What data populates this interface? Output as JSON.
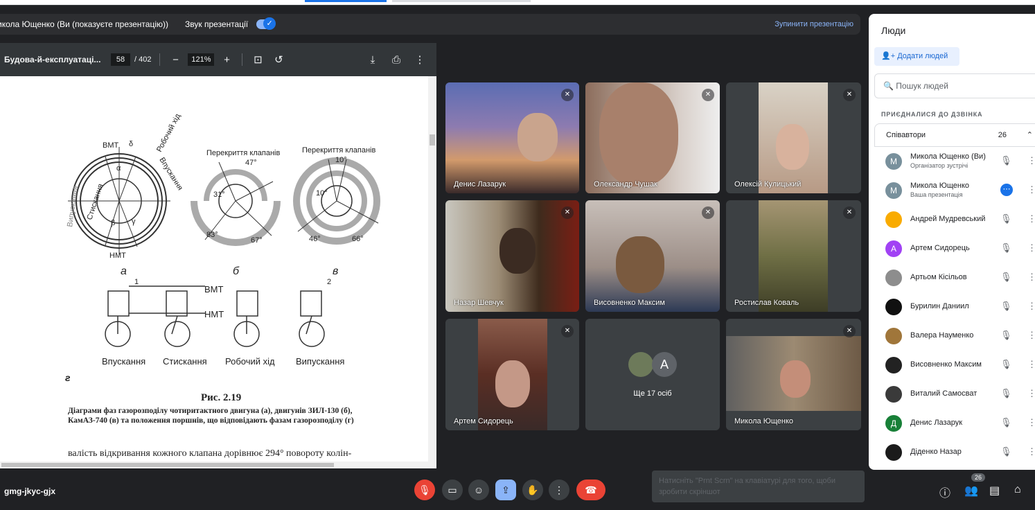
{
  "presentation_bar": {
    "presenter": "икола Ющенко (Ви (показуєте презентацію))",
    "sound_label": "Звук презентації",
    "sound_on": true,
    "stop_label": "Зупинити презентацію"
  },
  "pdf_viewer": {
    "filename": "Будова-й-експлуатаці...",
    "page": "58",
    "total_pages": "/ 402",
    "zoom": "121%",
    "content": {
      "bmt_a": "ВМТ",
      "nmt_a": "НМТ",
      "delta": "δ",
      "alpha": "α",
      "beta": "β",
      "gamma": "γ",
      "label_vypuskannya_vert": "Випускання",
      "label_stysk": "Стискання",
      "label_vpusk": "Впускання",
      "label_robochyi": "Робочий хід",
      "overlap": "Перекриття клапанів",
      "ang_47": "47°",
      "ang_31": "31°",
      "ang_83": "83°",
      "ang_67": "67°",
      "ang_10a": "10°",
      "ang_10b": "10°",
      "ang_46": "46°",
      "ang_66": "66°",
      "sub_a": "а",
      "sub_b": "б",
      "sub_v": "в",
      "sub_g": "г",
      "bmt_b": "ВМТ",
      "nmt_b": "НМТ",
      "num1": "1",
      "num2": "2",
      "stroke1": "Впускання",
      "stroke2": "Стискання",
      "stroke3": "Робочий хід",
      "stroke4": "Випускання",
      "fig": "Рис.  2.19",
      "caption1": "Діаграми фаз газорозподілу чотиритактного двигуна (а), двигунів ЗИЛ-130 (б),",
      "caption2": "КамАЗ-740 (в) та положення поршнів, що відповідають фазам газорозподілу (г)",
      "body": "валість відкривання кожного клапана дорівнює 294° повороту колін-"
    }
  },
  "tiles": [
    {
      "name": "Денис Лазарук"
    },
    {
      "name": "Олександр Чушак"
    },
    {
      "name": "Олексій Кулицький"
    },
    {
      "name": "Назар Шевчук"
    },
    {
      "name": "Висовненко Максим"
    },
    {
      "name": "Ростислав Коваль"
    },
    {
      "name": "Артем Сидорець"
    },
    {
      "name": "Ще 17 осіб",
      "avatar_letter": "А"
    },
    {
      "name": "Микола Ющенко"
    }
  ],
  "people_panel": {
    "title": "Люди",
    "add_button": "Додати людей",
    "search_placeholder": "Пошук людей",
    "section": "ПРИЄДНАЛИСЯ ДО ДЗВІНКА",
    "group": "Співавтори",
    "count": "26",
    "people": [
      {
        "name": "Микола Ющенко (Ви)",
        "sub": "Організатор зустрічі",
        "letter": "М",
        "color": "#78909c"
      },
      {
        "name": "Микола Ющенко",
        "sub": "Ваша презентація",
        "letter": "М",
        "color": "#78909c"
      },
      {
        "name": "Андрей Мудревський",
        "sub": "",
        "letter": "",
        "color": "#f9ab00"
      },
      {
        "name": "Артем Сидорець",
        "sub": "",
        "letter": "А",
        "color": "#a142f4"
      },
      {
        "name": "Артьом Кісільов",
        "sub": "",
        "letter": "",
        "color": "#8d8d8d"
      },
      {
        "name": "Бурилин Даниил",
        "sub": "",
        "letter": "",
        "color": "#111111"
      },
      {
        "name": "Валера Науменко",
        "sub": "",
        "letter": "",
        "color": "#a0763a"
      },
      {
        "name": "Висовненко Максим",
        "sub": "",
        "letter": "",
        "color": "#222222"
      },
      {
        "name": "Виталий Самосват",
        "sub": "",
        "letter": "",
        "color": "#3a3a3a"
      },
      {
        "name": "Денис Лазарук",
        "sub": "",
        "letter": "Д",
        "color": "#188038"
      },
      {
        "name": "Діденко Назар",
        "sub": "",
        "letter": "",
        "color": "#1b1b1b"
      }
    ]
  },
  "bottom_bar": {
    "meeting_code": "gmg-jkyc-gjx",
    "toast": "Натисніть \"Prnt Scrn\" на клавіатурі для того, щоби зробити скріншот",
    "people_badge": "26"
  },
  "colors": {
    "end_call": "#ea4335",
    "present": "#8ab4f8",
    "accent": "#1a73e8"
  }
}
